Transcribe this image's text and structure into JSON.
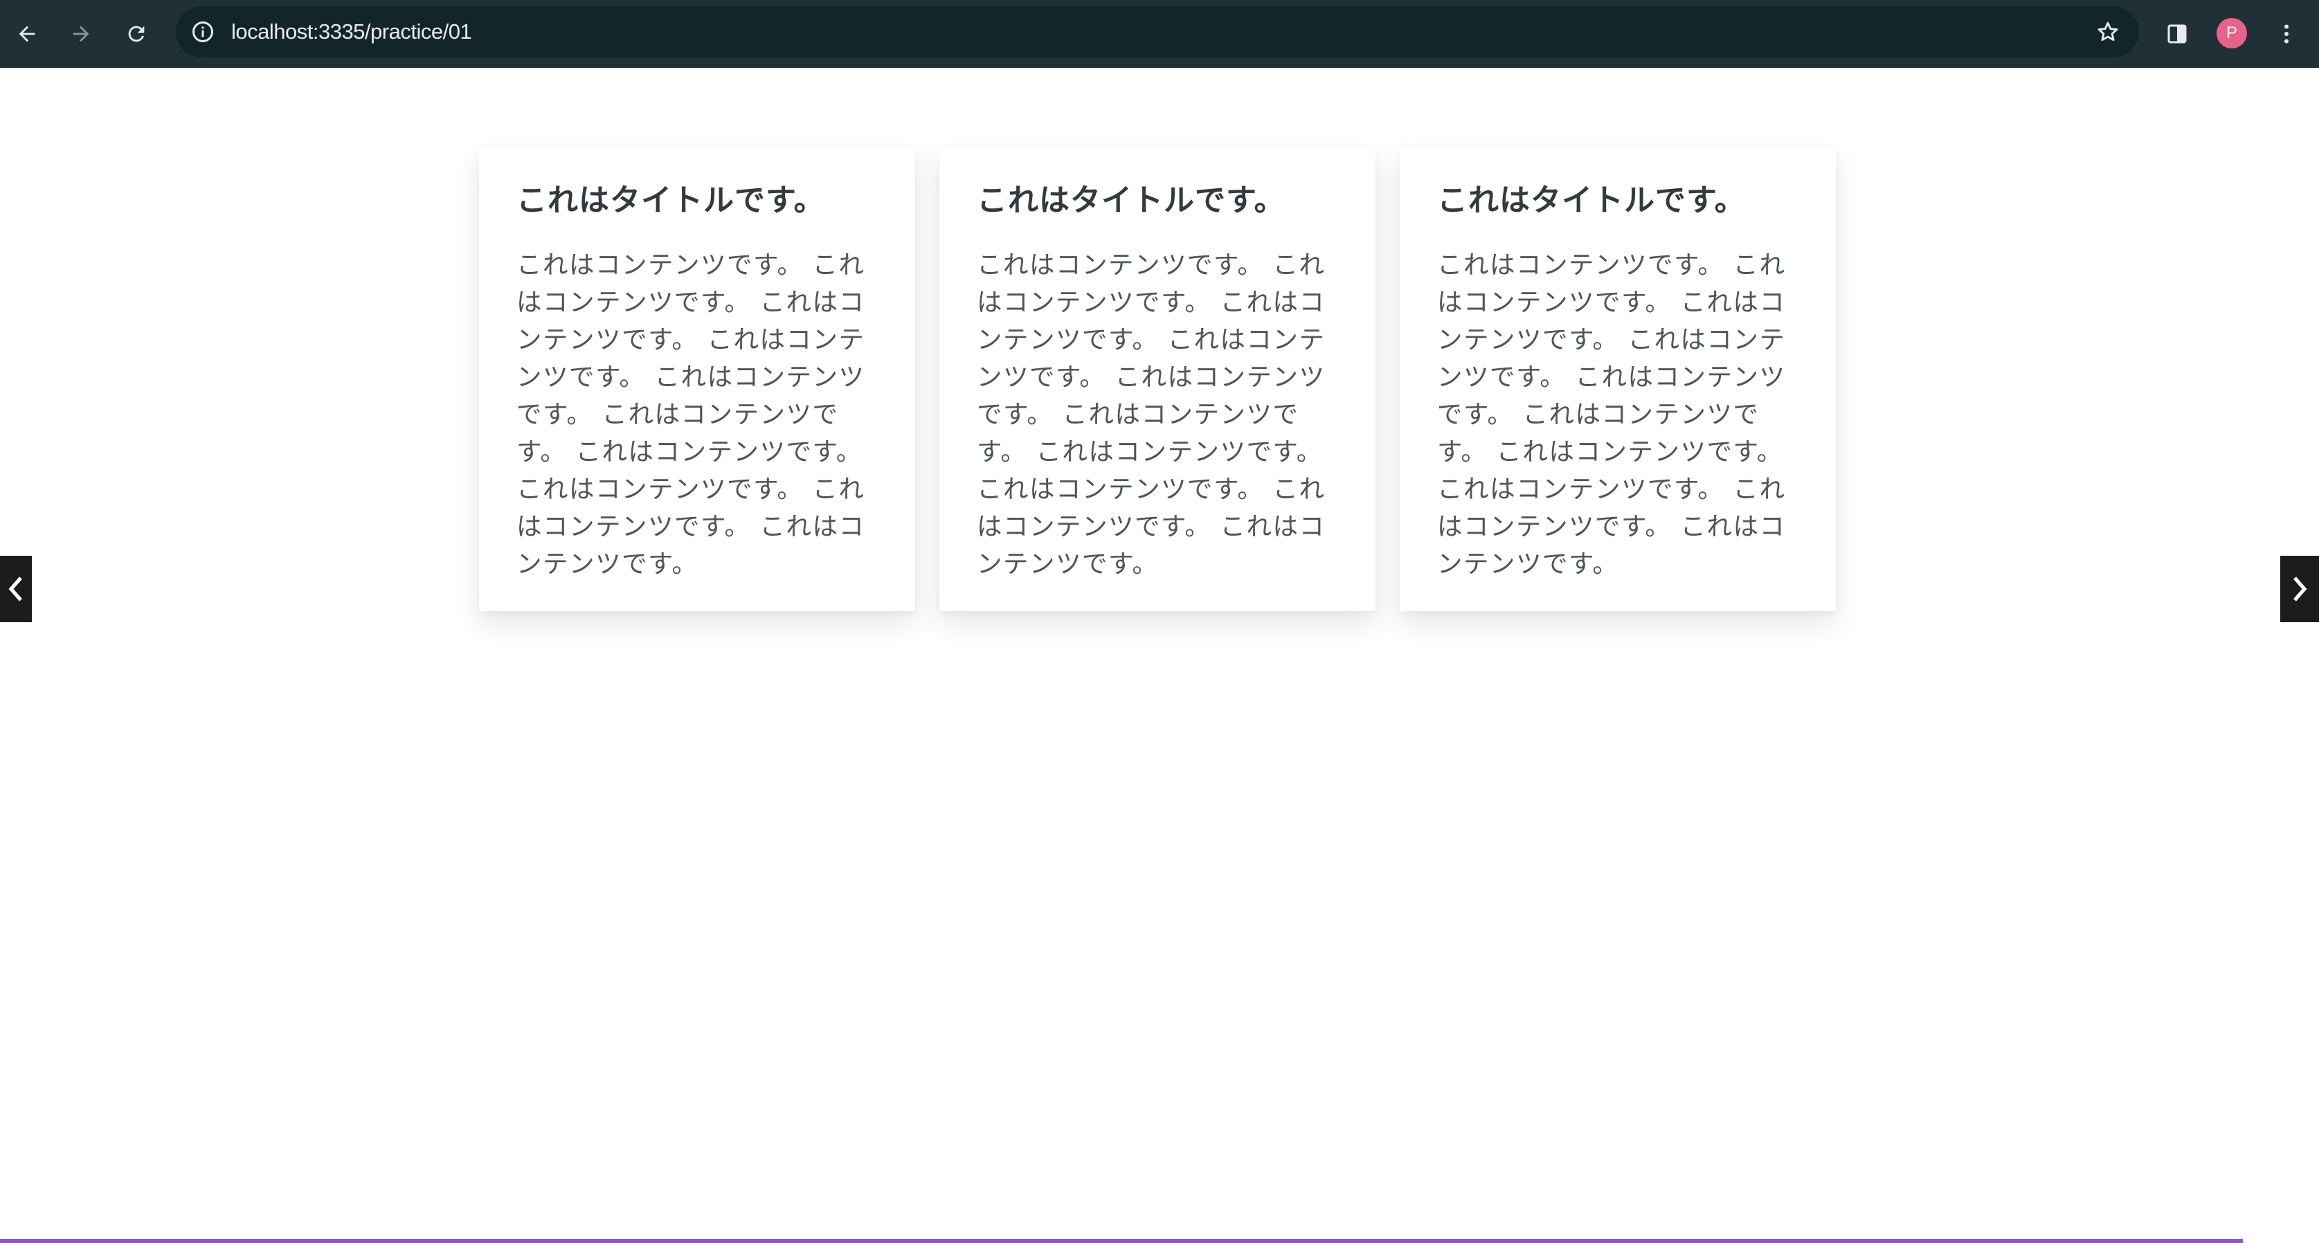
{
  "browser": {
    "url": "localhost:3335/practice/01",
    "profile_initial": "P",
    "icons": {
      "back": "arrow-left-icon",
      "forward": "arrow-right-icon",
      "reload": "reload-icon",
      "site_info": "info-circle-icon",
      "bookmark": "star-icon",
      "side_panel": "side-panel-icon",
      "menu": "kebab-menu-icon"
    },
    "colors": {
      "toolbar": "#1f3137",
      "omnibox": "#12252b",
      "avatar": "#e8628a"
    }
  },
  "carousel": {
    "prev_icon": "chevron-left-icon",
    "next_icon": "chevron-right-icon",
    "cards": [
      {
        "title": "これはタイトルです。",
        "body": "これはコンテンツです。 これはコンテンツです。 これはコンテンツです。 これはコンテンツです。 これはコンテンツです。 これはコンテンツです。 これはコンテンツです。 これはコンテンツです。 これはコンテンツです。 これはコンテンツです。"
      },
      {
        "title": "これはタイトルです。",
        "body": "これはコンテンツです。 これはコンテンツです。 これはコンテンツです。 これはコンテンツです。 これはコンテンツです。 これはコンテンツです。 これはコンテンツです。 これはコンテンツです。 これはコンテンツです。 これはコンテンツです。"
      },
      {
        "title": "これはタイトルです。",
        "body": "これはコンテンツです。 これはコンテンツです。 これはコンテンツです。 これはコンテンツです。 これはコンテンツです。 これはコンテンツです。 これはコンテンツです。 これはコンテンツです。 これはコンテンツです。 これはコンテンツです。"
      }
    ]
  }
}
